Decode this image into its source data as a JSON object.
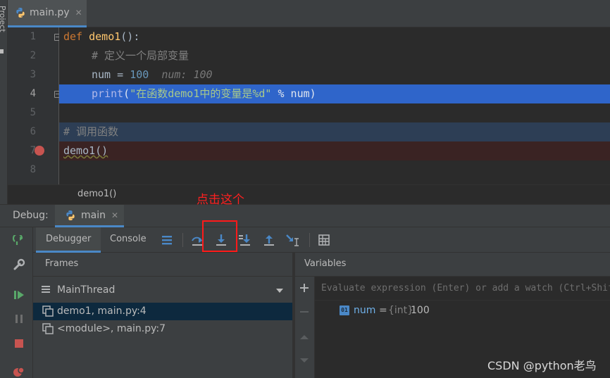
{
  "project_panel": {
    "label": "Project"
  },
  "editor_tab": {
    "filename": "main.py",
    "close": "✕"
  },
  "code_lines": [
    {
      "n": "1"
    },
    {
      "n": "2"
    },
    {
      "n": "3"
    },
    {
      "n": "4"
    },
    {
      "n": "5"
    },
    {
      "n": "6"
    },
    {
      "n": "7"
    },
    {
      "n": "8"
    }
  ],
  "code": {
    "l1_kw": "def",
    "l1_fn": "demo1",
    "l1_rest": "():",
    "l2_comment": "# 定义一个局部变量",
    "l3_var": "num = ",
    "l3_num": "100",
    "l3_hint": "num: 100",
    "l4_builtin": "print",
    "l4_open": "(",
    "l4_str": "\"在函数demo1中的变量是%d\"",
    "l4_rest": " % num)",
    "l6_comment": "# 调用函数",
    "l7_call": "demo1()"
  },
  "breadcrumb": {
    "text": "demo1()"
  },
  "annotation": {
    "text": "点击这个",
    "color": "#ff2020"
  },
  "debug": {
    "title_label": "Debug:",
    "session_tab": "main",
    "close": "✕",
    "tabs": {
      "debugger": "Debugger",
      "console": "Console"
    },
    "frames_header": "Frames",
    "thread": "MainThread",
    "frames": [
      {
        "label": "demo1, main.py:4",
        "selected": true
      },
      {
        "label": "<module>, main.py:7",
        "selected": false
      }
    ],
    "variables_header": "Variables",
    "eval_placeholder": "Evaluate expression (Enter) or add a watch (Ctrl+Shift+Enter)",
    "variable": {
      "icon": "01",
      "name": "num",
      "eq": "=",
      "type": "{int}",
      "value": "100"
    }
  },
  "colors": {
    "accent": "#4a88c7",
    "selection": "#2f65ca",
    "breakpoint": "#c75450"
  },
  "watermark": "CSDN @python老鸟"
}
